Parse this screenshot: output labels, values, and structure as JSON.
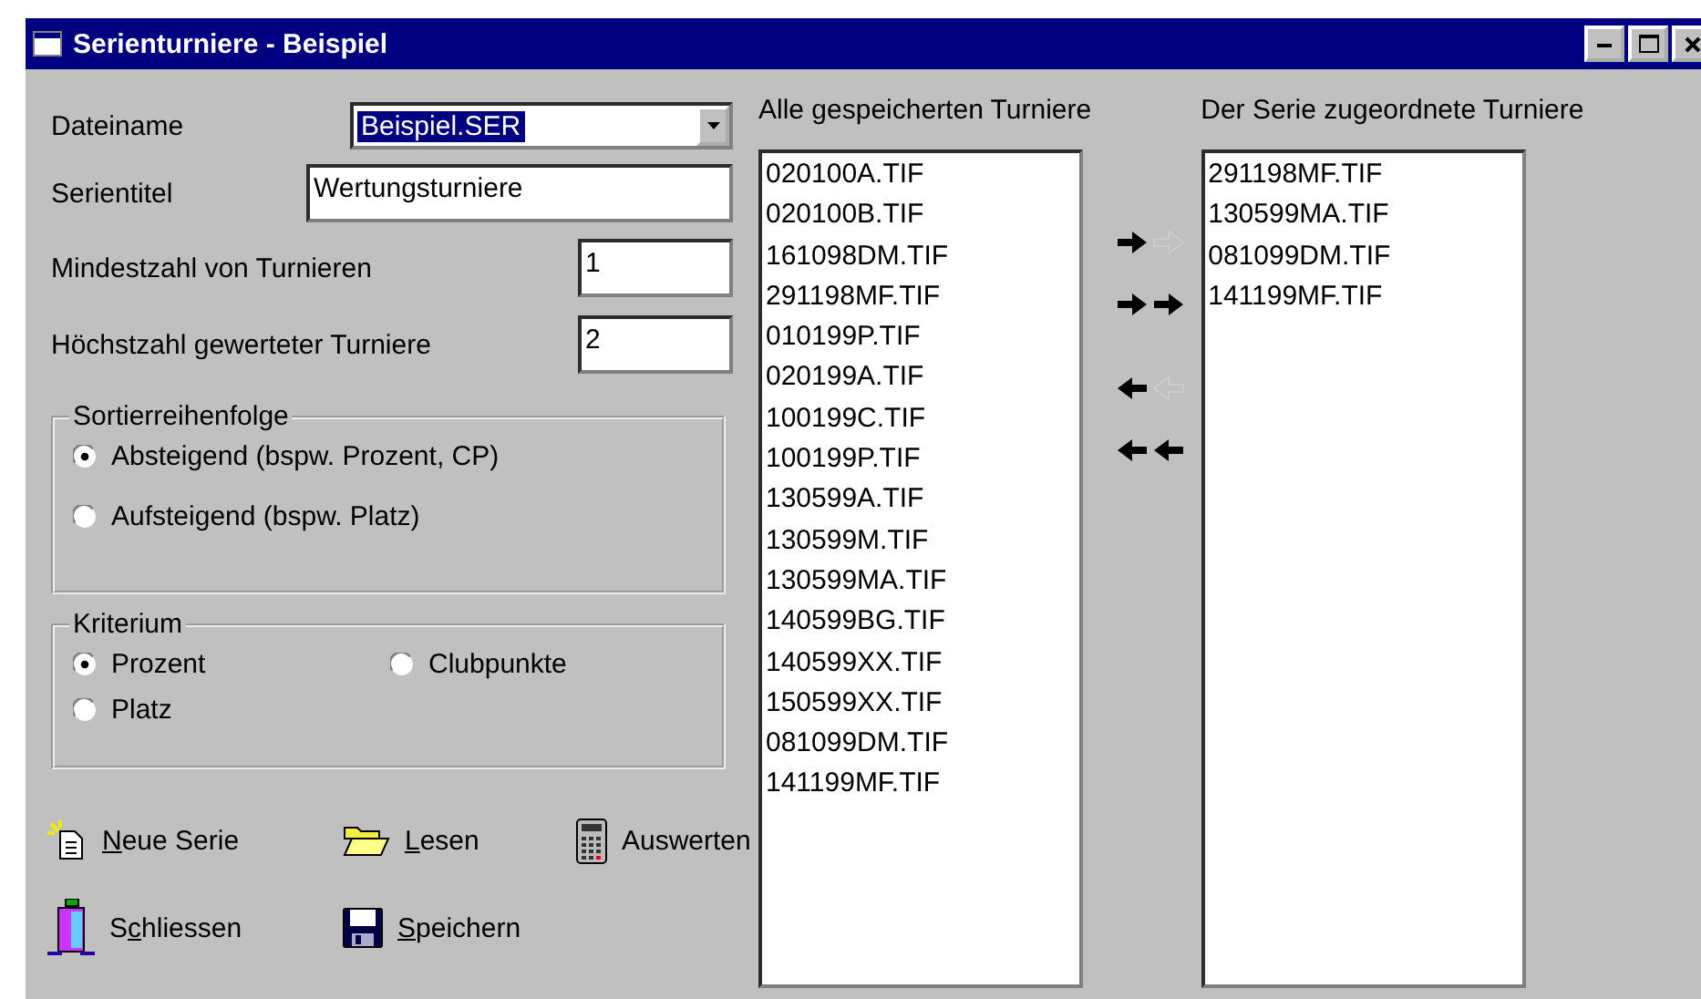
{
  "window": {
    "title": "Serienturniere - Beispiel"
  },
  "fields": [
    {
      "kind": "combo",
      "label": "Dateiname",
      "value": "Beispiel.SER",
      "focused": true
    },
    {
      "kind": "text",
      "label": "Serientitel",
      "value": "Wertungsturniere"
    },
    {
      "kind": "number",
      "label": "Mindestzahl von Turnieren",
      "value": "1"
    },
    {
      "kind": "number",
      "label": "Höchstzahl gewerteter Turniere",
      "value": "2"
    }
  ],
  "sort_order": {
    "title": "Sortierreihenfolge",
    "options": [
      {
        "label": "Absteigend (bspw. Prozent, CP)",
        "selected": true
      },
      {
        "label": "Aufsteigend (bspw. Platz)",
        "selected": false
      }
    ]
  },
  "criterion": {
    "title": "Kriterium",
    "options": [
      {
        "label": "Prozent",
        "selected": true
      },
      {
        "label": "Clubpunkte",
        "selected": false
      },
      {
        "label": "Platz",
        "selected": false
      }
    ]
  },
  "buttons": [
    {
      "kind": "new",
      "key": "N",
      "after": "eue Serie"
    },
    {
      "kind": "open",
      "key": "L",
      "after": "esen"
    },
    {
      "kind": "evaluate",
      "before": "Auswerten"
    },
    {
      "kind": "close",
      "before": "S",
      "key": "c",
      "after": "hliessen"
    },
    {
      "kind": "save",
      "key": "S",
      "after": "peichern"
    }
  ],
  "all_tournaments": {
    "title": "Alle gespeicherten Turniere",
    "items": [
      "020100A.TIF",
      "020100B.TIF",
      "161098DM.TIF",
      "291198MF.TIF",
      "010199P.TIF",
      "020199A.TIF",
      "100199C.TIF",
      "100199P.TIF",
      "130599A.TIF",
      "130599M.TIF",
      "130599MA.TIF",
      "140599BG.TIF",
      "140599XX.TIF",
      "150599XX.TIF",
      "081099DM.TIF",
      "141199MF.TIF"
    ]
  },
  "transfer_buttons": [
    {
      "kind": "add-one"
    },
    {
      "kind": "add-all"
    },
    {
      "kind": "remove-one"
    },
    {
      "kind": "remove-all"
    }
  ],
  "series_tournaments": {
    "title": "Der Serie zugeordnete Turniere",
    "items": [
      "291198MF.TIF",
      "130599MA.TIF",
      "081099DM.TIF",
      "141199MF.TIF"
    ]
  }
}
